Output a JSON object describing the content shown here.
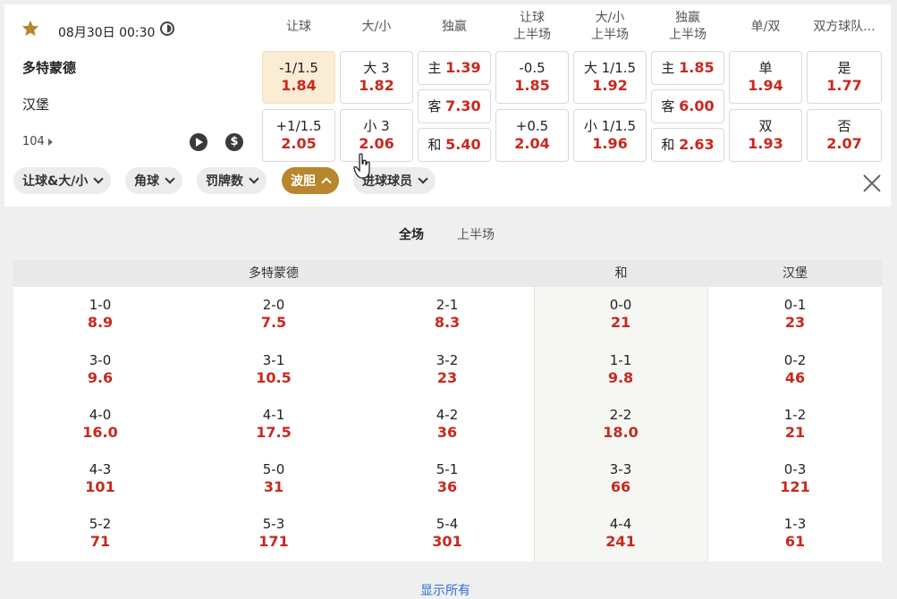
{
  "match": {
    "datetime": "08月30日 00:30",
    "home": "多特蒙德",
    "away": "汉堡",
    "more_count": "104"
  },
  "columns": [
    "让球",
    "大/小",
    "独赢",
    "让球\n上半场",
    "大/小\n上半场",
    "独赢\n上半场",
    "单/双",
    "双方球队..."
  ],
  "odds": {
    "hcp": [
      {
        "label": "-1/1.5",
        "odd": "1.84"
      },
      {
        "label": "+1/1.5",
        "odd": "2.05"
      }
    ],
    "ou": [
      {
        "label": "大 3",
        "odd": "1.82"
      },
      {
        "label": "小 3",
        "odd": "2.06"
      }
    ],
    "ml": [
      {
        "label": "主",
        "odd": "1.39"
      },
      {
        "label": "客",
        "odd": "7.30"
      },
      {
        "label": "和",
        "odd": "5.40"
      }
    ],
    "hcp_1h": [
      {
        "label": "-0.5",
        "odd": "1.85"
      },
      {
        "label": "+0.5",
        "odd": "2.04"
      }
    ],
    "ou_1h": [
      {
        "label": "大 1/1.5",
        "odd": "1.92"
      },
      {
        "label": "小 1/1.5",
        "odd": "1.96"
      }
    ],
    "ml_1h": [
      {
        "label": "主",
        "odd": "1.85"
      },
      {
        "label": "客",
        "odd": "6.00"
      },
      {
        "label": "和",
        "odd": "2.63"
      }
    ],
    "oe": [
      {
        "label": "单",
        "odd": "1.94"
      },
      {
        "label": "双",
        "odd": "1.93"
      }
    ],
    "btts": [
      {
        "label": "是",
        "odd": "1.77"
      },
      {
        "label": "否",
        "odd": "2.07"
      }
    ]
  },
  "filters": [
    "让球&大/小",
    "角球",
    "罚牌数",
    "波胆",
    "进球球员"
  ],
  "active_filter": "波胆",
  "tabs": [
    "全场",
    "上半场"
  ],
  "cs_headers": [
    "多特蒙德",
    "和",
    "汉堡"
  ],
  "cs_rows": [
    [
      {
        "s": "1-0",
        "o": "8.9"
      },
      {
        "s": "2-0",
        "o": "7.5"
      },
      {
        "s": "2-1",
        "o": "8.3"
      },
      {
        "s": "0-0",
        "o": "21"
      },
      {
        "s": "0-1",
        "o": "23"
      }
    ],
    [
      {
        "s": "3-0",
        "o": "9.6"
      },
      {
        "s": "3-1",
        "o": "10.5"
      },
      {
        "s": "3-2",
        "o": "23"
      },
      {
        "s": "1-1",
        "o": "9.8"
      },
      {
        "s": "0-2",
        "o": "46"
      }
    ],
    [
      {
        "s": "4-0",
        "o": "16.0"
      },
      {
        "s": "4-1",
        "o": "17.5"
      },
      {
        "s": "4-2",
        "o": "36"
      },
      {
        "s": "2-2",
        "o": "18.0"
      },
      {
        "s": "1-2",
        "o": "21"
      }
    ],
    [
      {
        "s": "4-3",
        "o": "101"
      },
      {
        "s": "5-0",
        "o": "31"
      },
      {
        "s": "5-1",
        "o": "36"
      },
      {
        "s": "3-3",
        "o": "66"
      },
      {
        "s": "0-3",
        "o": "121"
      }
    ],
    [
      {
        "s": "5-2",
        "o": "71"
      },
      {
        "s": "5-3",
        "o": "171"
      },
      {
        "s": "5-4",
        "o": "301"
      },
      {
        "s": "4-4",
        "o": "241"
      },
      {
        "s": "1-3",
        "o": "61"
      }
    ]
  ],
  "show_all": "显示所有",
  "colors": {
    "odd": "#c8281e",
    "accent": "#b7862d",
    "link": "#2a6fd6",
    "highlight": "#fbecd4"
  }
}
